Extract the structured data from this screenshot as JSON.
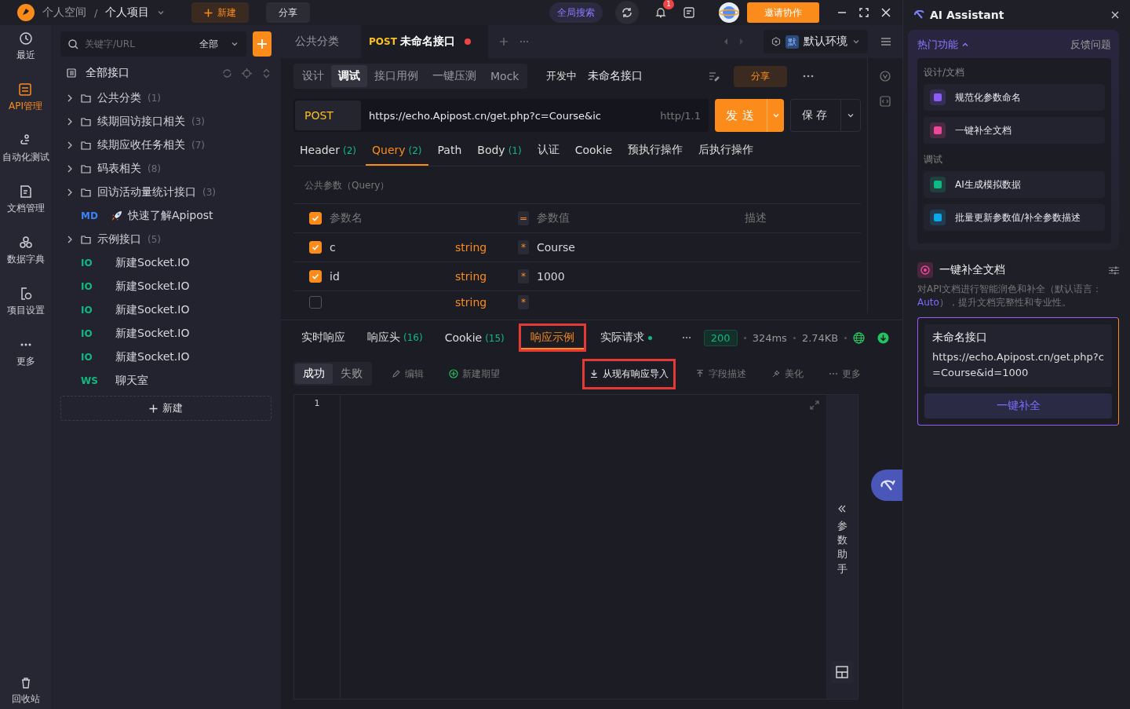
{
  "topbar": {
    "breadcrumb": [
      {
        "label": "个人空间"
      },
      {
        "label": "个人项目"
      }
    ],
    "separator": "/",
    "new_button": "新建",
    "share_button": "分享",
    "search_button": "全局搜索",
    "notification_count": "1",
    "invite_button": "邀请协作"
  },
  "rail": {
    "items": [
      {
        "label": "最近",
        "selected": false
      },
      {
        "label": "API管理",
        "selected": true
      },
      {
        "label": "自动化测试",
        "selected": false
      },
      {
        "label": "文档管理",
        "selected": false
      },
      {
        "label": "数据字典",
        "selected": false
      },
      {
        "label": "项目设置",
        "selected": false
      },
      {
        "label": "更多",
        "selected": false
      }
    ],
    "trash": "回收站"
  },
  "tree": {
    "search_placeholder": "关键字/URL",
    "filter": "全部",
    "root": "全部接口",
    "new_button": "新建",
    "items": [
      {
        "kind": "folder",
        "label": "公共分类",
        "count": "(1)"
      },
      {
        "kind": "folder",
        "label": "续期回访接口相关",
        "count": "(3)"
      },
      {
        "kind": "folder",
        "label": "续期应收任务相关",
        "count": "(7)"
      },
      {
        "kind": "folder",
        "label": "码表相关",
        "count": "(8)"
      },
      {
        "kind": "folder",
        "label": "回访活动量统计接口",
        "count": "(3)"
      },
      {
        "kind": "doc",
        "badge": "MD",
        "label": "快速了解Apipost"
      },
      {
        "kind": "folder",
        "label": "示例接口",
        "count": "(5)"
      },
      {
        "kind": "socket",
        "badge": "IO",
        "label": "新建Socket.IO"
      },
      {
        "kind": "socket",
        "badge": "IO",
        "label": "新建Socket.IO"
      },
      {
        "kind": "socket",
        "badge": "IO",
        "label": "新建Socket.IO"
      },
      {
        "kind": "socket",
        "badge": "IO",
        "label": "新建Socket.IO"
      },
      {
        "kind": "socket",
        "badge": "IO",
        "label": "新建Socket.IO"
      },
      {
        "kind": "socket",
        "badge": "WS",
        "label": "聊天室"
      }
    ]
  },
  "tabs": [
    {
      "label": "公共分类",
      "selected": false,
      "unsaved": false
    },
    {
      "method": "POST",
      "label": "未命名接口",
      "selected": true,
      "unsaved": true
    }
  ],
  "environment": {
    "badge": "默",
    "label": "默认环境"
  },
  "mode_tabs": [
    {
      "label": "设计",
      "selected": false
    },
    {
      "label": "调试",
      "selected": true
    },
    {
      "label": "接口用例",
      "selected": false
    },
    {
      "label": "一键压测",
      "selected": false
    },
    {
      "label": "Mock",
      "selected": false
    }
  ],
  "status": "开发中",
  "api_name": "未命名接口",
  "share_button": "分享",
  "request": {
    "method": "POST",
    "url": "https://echo.Apipost.cn/get.php?c=Course&ic",
    "protocol": "http/1.1",
    "send_button": "发送",
    "save_button": "保存"
  },
  "param_tabs": [
    {
      "label": "Header",
      "count": "(2)",
      "selected": false
    },
    {
      "label": "Query",
      "count": "(2)",
      "selected": true
    },
    {
      "label": "Path",
      "selected": false
    },
    {
      "label": "Body",
      "count": "(1)",
      "selected": false
    },
    {
      "label": "认证",
      "selected": false
    },
    {
      "label": "Cookie",
      "selected": false
    },
    {
      "label": "预执行操作",
      "selected": false
    },
    {
      "label": "后执行操作",
      "selected": false
    }
  ],
  "public_params": "公共参数（Query）",
  "params": {
    "all_checked": true,
    "columns": {
      "name": "参数名",
      "equals": "=",
      "value": "参数值",
      "description": "描述"
    },
    "rows": [
      {
        "checked": true,
        "name": "c",
        "type": "string",
        "required": "*",
        "value": "Course"
      },
      {
        "checked": true,
        "name": "id",
        "type": "string",
        "required": "*",
        "value": "1000"
      },
      {
        "checked": false,
        "type": "string",
        "required": "*"
      }
    ]
  },
  "response": {
    "tabs": [
      {
        "label": "实时响应",
        "selected": false,
        "highlighted": false
      },
      {
        "label": "响应头",
        "count": "(16)",
        "selected": false,
        "highlighted": false
      },
      {
        "label": "Cookie",
        "count": "(15)",
        "selected": false,
        "highlighted": false
      },
      {
        "label": "响应示例",
        "selected": true,
        "highlighted": true
      },
      {
        "label": "实际请求",
        "selected": false,
        "highlighted": false,
        "dot": true
      }
    ],
    "status_code": "200",
    "time": "324ms",
    "size": "2.74KB"
  },
  "examples": {
    "outcomes": [
      {
        "label": "成功",
        "selected": true
      },
      {
        "label": "失败",
        "selected": false
      }
    ],
    "actions": [
      {
        "label": "编辑",
        "highlighted": false
      },
      {
        "label": "新建期望",
        "highlighted": false
      },
      {
        "label": "从现有响应导入",
        "highlighted": true
      },
      {
        "label": "字段描述",
        "highlighted": false
      },
      {
        "label": "美化",
        "highlighted": false
      },
      {
        "label": "更多",
        "highlighted": false
      }
    ]
  },
  "editor": {
    "line_numbers": [
      "1"
    ],
    "helper": "参数助手"
  },
  "ai": {
    "title": "AI Assistant",
    "hot": "热门功能",
    "feedback": "反馈问题",
    "groups": [
      {
        "title": "设计/文档",
        "items": [
          {
            "label": "规范化参数命名",
            "color": "#8b5cf6"
          },
          {
            "label": "一键补全文档",
            "color": "#ec4899"
          }
        ]
      },
      {
        "title": "调试",
        "items": [
          {
            "label": "AI生成模拟数据",
            "color": "#10b981"
          },
          {
            "label": "批量更新参数值/补全参数描述",
            "color": "#0ea5e9"
          }
        ]
      }
    ],
    "section_title": "一键补全文档",
    "desc_before": "对API文档进行智能润色和补全（默认语言：",
    "desc_link": "Auto",
    "desc_after": "），提升文档完整性和专业性。",
    "card_title": "未命名接口",
    "card_url": "https://echo.Apipost.cn/get.php?c=Course&id=1000",
    "card_button": "一键补全"
  }
}
